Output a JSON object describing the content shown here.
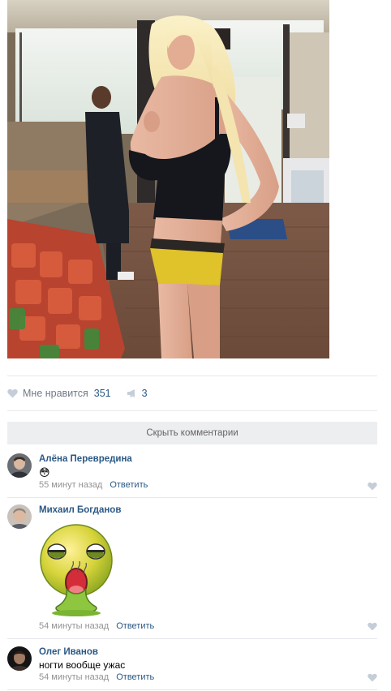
{
  "post": {
    "like_label": "Мне нравится",
    "like_count": "351",
    "share_count": "3",
    "hide_comments_label": "Скрыть комментарии"
  },
  "comments": [
    {
      "author": "Алёна Перевредина",
      "text": "😳",
      "time": "55 минут назад",
      "reply": "Ответить"
    },
    {
      "author": "Михаил Богданов",
      "text": "",
      "time": "54 минуты назад",
      "reply": "Ответить"
    },
    {
      "author": "Олег Иванов",
      "text": "ногти вообще ужас",
      "time": "54 минуты назад",
      "reply": "Ответить"
    }
  ],
  "colors": {
    "link": "#2a5885",
    "muted": "#939393",
    "divider": "#e7e8ec",
    "button_bg": "#edeef0"
  }
}
